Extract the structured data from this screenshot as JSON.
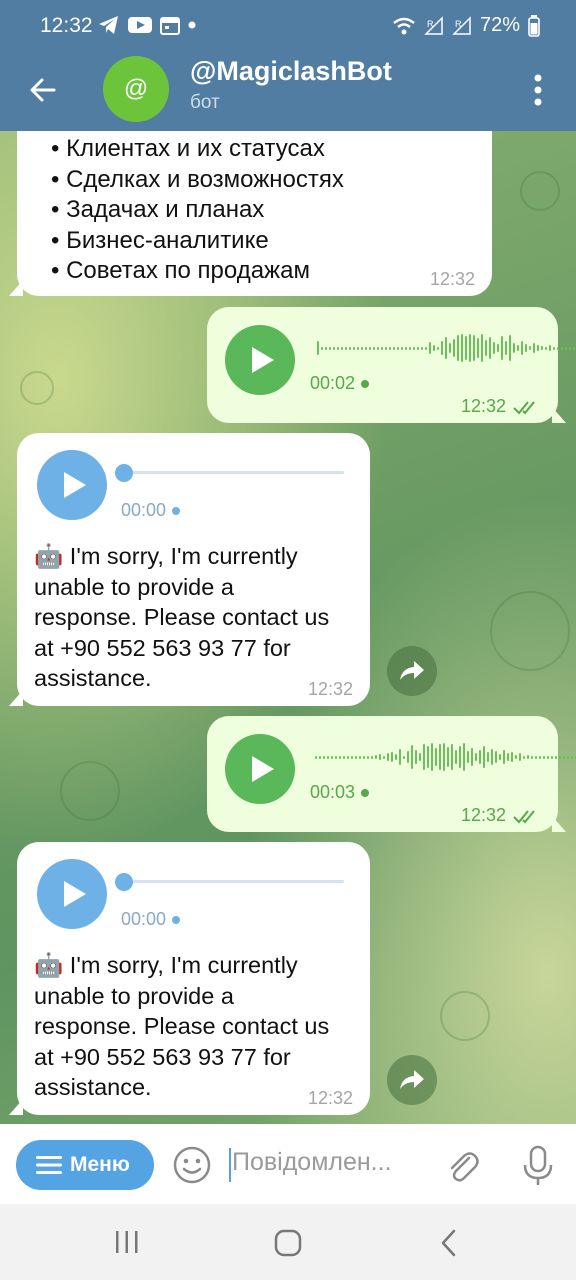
{
  "status_bar": {
    "time": "12:32",
    "battery": "72%",
    "left_icons": [
      "telegram-icon",
      "youtube-icon",
      "calendar-icon",
      "dot-icon"
    ],
    "right_icons": [
      "wifi-icon",
      "signal-r-icon",
      "signal-r-icon",
      "battery-icon"
    ]
  },
  "header": {
    "avatar_symbol": "@",
    "title": "@MagiclashBot",
    "subtitle": "бот"
  },
  "messages": {
    "m1": {
      "items": [
        "Клиентах и их статусах",
        "Сделках и возможностях",
        "Задачах и планах",
        "Бизнес-аналитике",
        "Советах по продажам"
      ],
      "time": "12:32"
    },
    "m2": {
      "duration": "00:02",
      "time": "12:32",
      "read": true
    },
    "m3": {
      "duration": "00:00",
      "emoji": "🤖",
      "text": "I'm sorry, I'm currently unable to provide a response. Please contact us at +90 552 563 93 77 for assistance.",
      "time": "12:32"
    },
    "m4": {
      "duration": "00:03",
      "time": "12:32",
      "read": true
    },
    "m5": {
      "duration": "00:00",
      "emoji": "🤖",
      "text": "I'm sorry, I'm currently unable to provide a response. Please contact us at +90 552 563 93 77 for assistance.",
      "time": "12:32"
    }
  },
  "input": {
    "menu_label": "Меню",
    "placeholder": "Повідомлен..."
  },
  "colors": {
    "header": "#517da2",
    "out_bubble": "#effedd",
    "in_bubble": "#ffffff",
    "accent_green": "#5bb85a",
    "accent_blue": "#6eb1e6"
  }
}
